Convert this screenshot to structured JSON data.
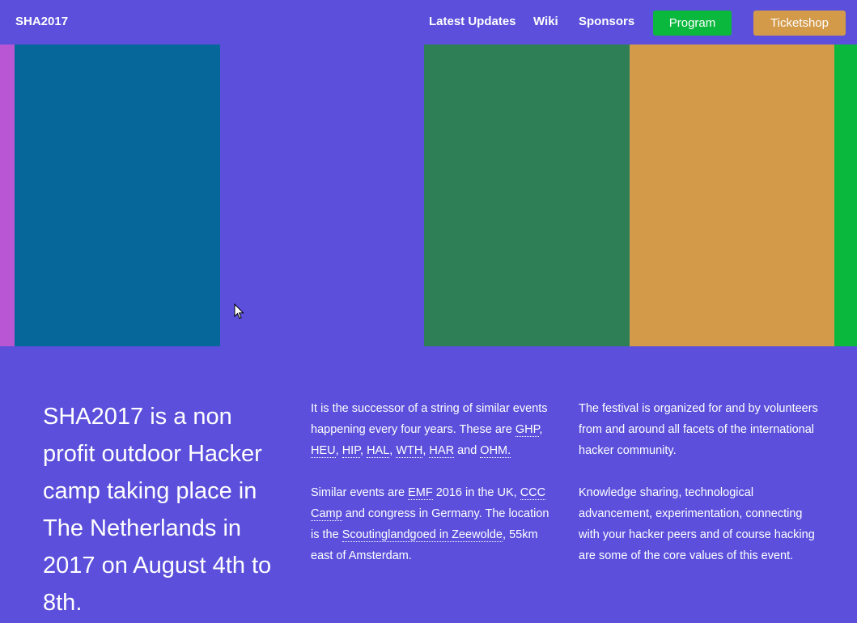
{
  "header": {
    "brand": "SHA2017",
    "nav": [
      "Latest Updates",
      "Wiki",
      "Sponsors"
    ],
    "program_label": "Program",
    "ticketshop_label": "Ticketshop"
  },
  "colors": {
    "background": "#5b4fdb",
    "purple_tile": "#b956d4",
    "blue_tile": "#06689a",
    "green_tile": "#2e7f55",
    "orange_tile": "#d39a4a",
    "bright_green": "#0ab83d"
  },
  "headline": "SHA2017 is a non profit outdoor Hacker camp taking place in The Netherlands in 2017 on August 4th to 8th.",
  "middle": {
    "p1_lead": "It is the successor of a string of similar events happening every four years. These are ",
    "events": [
      "GHP",
      "HEU",
      "HIP",
      "HAL",
      "WTH",
      "HAR",
      "OHM."
    ],
    "p1_and": " and ",
    "sep": ", ",
    "p2_a": "Similar events are ",
    "emf": "EMF",
    "p2_b": " 2016 in the UK, ",
    "ccc": "CCC Camp",
    "p2_c": " and congress in Germany. The location is the ",
    "location": "Scoutinglandgoed in Zeewolde",
    "p2_d": ", 55km east of Amsterdam."
  },
  "right": {
    "p1": "The festival is organized for and by volunteers from and around all facets of the international hacker community.",
    "p2": "Knowledge sharing, technological advancement, experimentation, connecting with your hacker peers and of course hacking are some of the core values of this event."
  }
}
